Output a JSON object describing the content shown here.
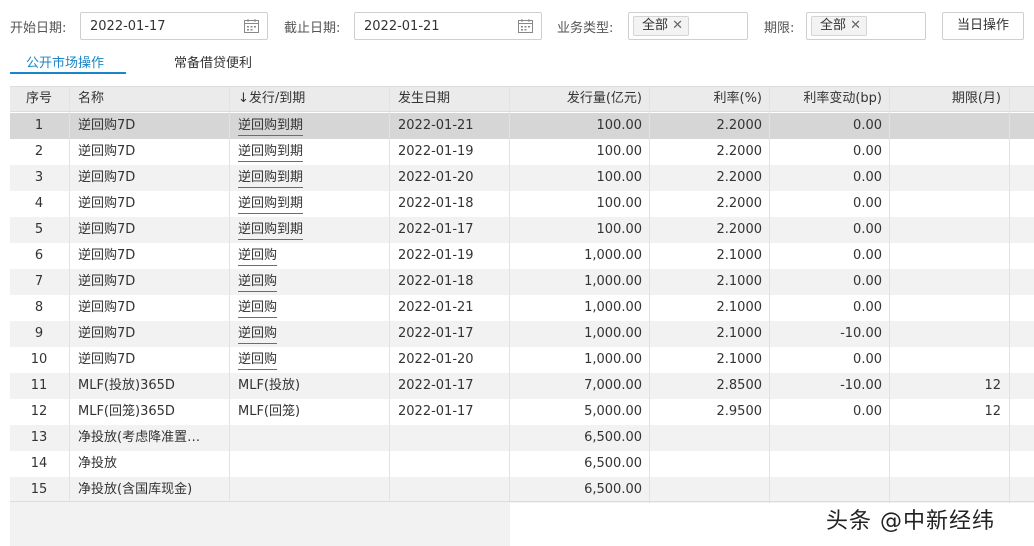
{
  "filters": {
    "start_label": "开始日期:",
    "start_value": "2022-01-17",
    "end_label": "截止日期:",
    "end_value": "2022-01-21",
    "biz_label": "业务类型:",
    "biz_tag": "全部",
    "term_label": "期限:",
    "term_tag": "全部",
    "today_button": "当日操作"
  },
  "tabs": [
    {
      "label": "公开市场操作",
      "active": true
    },
    {
      "label": "常备借贷便利",
      "active": false
    }
  ],
  "table": {
    "headers": [
      "序号",
      "名称",
      "↓发行/到期",
      "发生日期",
      "发行量(亿元)",
      "利率(%)",
      "利率变动(bp)",
      "期限(月)"
    ],
    "rows": [
      {
        "no": "1",
        "name": "逆回购7D",
        "type": "逆回购到期",
        "type_link": true,
        "date": "2022-01-21",
        "amount": "100.00",
        "rate": "2.2000",
        "change": "0.00",
        "term": ""
      },
      {
        "no": "2",
        "name": "逆回购7D",
        "type": "逆回购到期",
        "type_link": true,
        "date": "2022-01-19",
        "amount": "100.00",
        "rate": "2.2000",
        "change": "0.00",
        "term": ""
      },
      {
        "no": "3",
        "name": "逆回购7D",
        "type": "逆回购到期",
        "type_link": true,
        "date": "2022-01-20",
        "amount": "100.00",
        "rate": "2.2000",
        "change": "0.00",
        "term": ""
      },
      {
        "no": "4",
        "name": "逆回购7D",
        "type": "逆回购到期",
        "type_link": true,
        "date": "2022-01-18",
        "amount": "100.00",
        "rate": "2.2000",
        "change": "0.00",
        "term": ""
      },
      {
        "no": "5",
        "name": "逆回购7D",
        "type": "逆回购到期",
        "type_link": true,
        "date": "2022-01-17",
        "amount": "100.00",
        "rate": "2.2000",
        "change": "0.00",
        "term": ""
      },
      {
        "no": "6",
        "name": "逆回购7D",
        "type": "逆回购",
        "type_link": true,
        "date": "2022-01-19",
        "amount": "1,000.00",
        "rate": "2.1000",
        "change": "0.00",
        "term": ""
      },
      {
        "no": "7",
        "name": "逆回购7D",
        "type": "逆回购",
        "type_link": true,
        "date": "2022-01-18",
        "amount": "1,000.00",
        "rate": "2.1000",
        "change": "0.00",
        "term": ""
      },
      {
        "no": "8",
        "name": "逆回购7D",
        "type": "逆回购",
        "type_link": true,
        "date": "2022-01-21",
        "amount": "1,000.00",
        "rate": "2.1000",
        "change": "0.00",
        "term": ""
      },
      {
        "no": "9",
        "name": "逆回购7D",
        "type": "逆回购",
        "type_link": true,
        "date": "2022-01-17",
        "amount": "1,000.00",
        "rate": "2.1000",
        "change": "-10.00",
        "term": ""
      },
      {
        "no": "10",
        "name": "逆回购7D",
        "type": "逆回购",
        "type_link": true,
        "date": "2022-01-20",
        "amount": "1,000.00",
        "rate": "2.1000",
        "change": "0.00",
        "term": ""
      },
      {
        "no": "11",
        "name": "MLF(投放)365D",
        "type": "MLF(投放)",
        "type_link": false,
        "date": "2022-01-17",
        "amount": "7,000.00",
        "rate": "2.8500",
        "change": "-10.00",
        "term": "12"
      },
      {
        "no": "12",
        "name": "MLF(回笼)365D",
        "type": "MLF(回笼)",
        "type_link": false,
        "date": "2022-01-17",
        "amount": "5,000.00",
        "rate": "2.9500",
        "change": "0.00",
        "term": "12"
      },
      {
        "no": "13",
        "name": "净投放(考虑降准置…",
        "type": "",
        "type_link": false,
        "date": "",
        "amount": "6,500.00",
        "rate": "",
        "change": "",
        "term": ""
      },
      {
        "no": "14",
        "name": "净投放",
        "type": "",
        "type_link": false,
        "date": "",
        "amount": "6,500.00",
        "rate": "",
        "change": "",
        "term": ""
      },
      {
        "no": "15",
        "name": "净投放(含国库现金)",
        "type": "",
        "type_link": false,
        "date": "",
        "amount": "6,500.00",
        "rate": "",
        "change": "",
        "term": ""
      }
    ]
  },
  "watermark": "头条 @中新经纬"
}
